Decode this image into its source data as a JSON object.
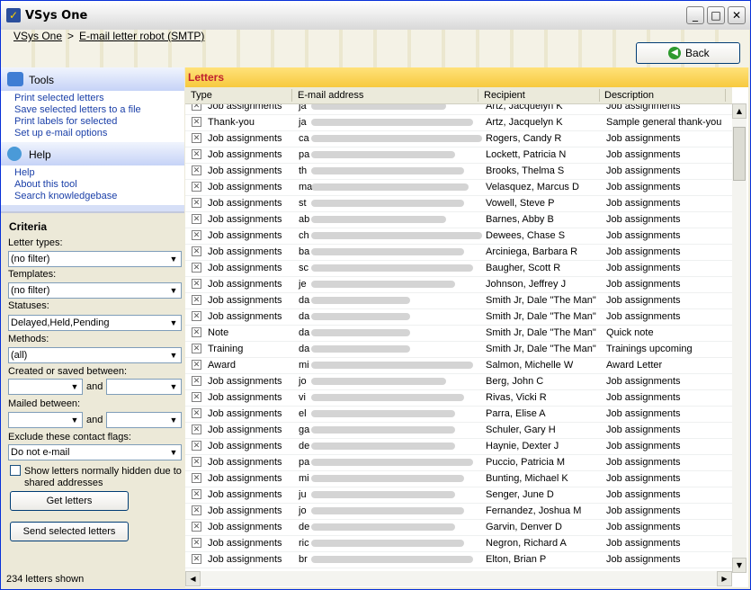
{
  "window": {
    "title": "VSys One"
  },
  "breadcrumb": {
    "home": "VSys One",
    "separator": ">",
    "current": "E-mail letter robot (SMTP)"
  },
  "back_button": {
    "label": "Back"
  },
  "tools": {
    "title": "Tools",
    "links": [
      "Print selected letters",
      "Save selected letters to a file",
      "Print labels for selected",
      "Set up e-mail options"
    ]
  },
  "help": {
    "title": "Help",
    "links": [
      "Help",
      "About this tool",
      "Search knowledgebase"
    ]
  },
  "criteria": {
    "title": "Criteria",
    "letter_types_label": "Letter types:",
    "letter_types_value": "(no filter)",
    "templates_label": "Templates:",
    "templates_value": "(no filter)",
    "statuses_label": "Statuses:",
    "statuses_value": "Delayed,Held,Pending",
    "methods_label": "Methods:",
    "methods_value": "(all)",
    "created_label": "Created or saved between:",
    "and_label": "and",
    "mailed_label": "Mailed between:",
    "exclude_label": "Exclude these contact flags:",
    "exclude_value": "Do not e-mail",
    "hidden_checkbox_label": "Show letters normally hidden due to shared addresses",
    "get_letters_button": "Get letters",
    "send_button": "Send selected letters"
  },
  "status": {
    "text": "234 letters shown"
  },
  "letters": {
    "title": "Letters",
    "columns": [
      "Type",
      "E-mail address",
      "Recipient",
      "Description"
    ],
    "rows": [
      {
        "type": "Job assignments",
        "email": "ja",
        "recipient": "Artz, Jacquelyn K",
        "description": "Job assignments"
      },
      {
        "type": "Thank-you",
        "email": "ja",
        "recipient": "Artz, Jacquelyn K",
        "description": "Sample general thank-you"
      },
      {
        "type": "Job assignments",
        "email": "ca",
        "recipient": "Rogers, Candy R",
        "description": "Job assignments"
      },
      {
        "type": "Job assignments",
        "email": "pa",
        "recipient": "Lockett, Patricia N",
        "description": "Job assignments"
      },
      {
        "type": "Job assignments",
        "email": "th",
        "recipient": "Brooks, Thelma S",
        "description": "Job assignments"
      },
      {
        "type": "Job assignments",
        "email": "ma",
        "recipient": "Velasquez, Marcus D",
        "description": "Job assignments"
      },
      {
        "type": "Job assignments",
        "email": "st",
        "recipient": "Vowell, Steve P",
        "description": "Job assignments"
      },
      {
        "type": "Job assignments",
        "email": "ab",
        "recipient": "Barnes, Abby B",
        "description": "Job assignments"
      },
      {
        "type": "Job assignments",
        "email": "ch",
        "recipient": "Dewees, Chase S",
        "description": "Job assignments"
      },
      {
        "type": "Job assignments",
        "email": "ba",
        "recipient": "Arciniega, Barbara R",
        "description": "Job assignments"
      },
      {
        "type": "Job assignments",
        "email": "sc",
        "recipient": "Baugher, Scott R",
        "description": "Job assignments"
      },
      {
        "type": "Job assignments",
        "email": "je",
        "recipient": "Johnson, Jeffrey J",
        "description": "Job assignments"
      },
      {
        "type": "Job assignments",
        "email": "da",
        "recipient": "Smith Jr, Dale \"The Man\"",
        "description": "Job assignments"
      },
      {
        "type": "Job assignments",
        "email": "da",
        "recipient": "Smith Jr, Dale \"The Man\"",
        "description": "Job assignments"
      },
      {
        "type": "Note",
        "email": "da",
        "recipient": "Smith Jr, Dale \"The Man\"",
        "description": "Quick note"
      },
      {
        "type": "Training",
        "email": "da",
        "recipient": "Smith Jr, Dale \"The Man\"",
        "description": "Trainings upcoming"
      },
      {
        "type": "Award",
        "email": "mi",
        "recipient": "Salmon, Michelle W",
        "description": "Award Letter"
      },
      {
        "type": "Job assignments",
        "email": "jo",
        "recipient": "Berg, John C",
        "description": "Job assignments"
      },
      {
        "type": "Job assignments",
        "email": "vi",
        "recipient": "Rivas, Vicki R",
        "description": "Job assignments"
      },
      {
        "type": "Job assignments",
        "email": "el",
        "recipient": "Parra, Elise A",
        "description": "Job assignments"
      },
      {
        "type": "Job assignments",
        "email": "ga",
        "recipient": "Schuler, Gary H",
        "description": "Job assignments"
      },
      {
        "type": "Job assignments",
        "email": "de",
        "recipient": "Haynie, Dexter J",
        "description": "Job assignments"
      },
      {
        "type": "Job assignments",
        "email": "pa",
        "recipient": "Puccio, Patricia M",
        "description": "Job assignments"
      },
      {
        "type": "Job assignments",
        "email": "mi",
        "recipient": "Bunting, Michael K",
        "description": "Job assignments"
      },
      {
        "type": "Job assignments",
        "email": "ju",
        "recipient": "Senger, June D",
        "description": "Job assignments"
      },
      {
        "type": "Job assignments",
        "email": "jo",
        "recipient": "Fernandez, Joshua M",
        "description": "Job assignments"
      },
      {
        "type": "Job assignments",
        "email": "de",
        "recipient": "Garvin, Denver D",
        "description": "Job assignments"
      },
      {
        "type": "Job assignments",
        "email": "ric",
        "recipient": "Negron, Richard A",
        "description": "Job assignments"
      },
      {
        "type": "Job assignments",
        "email": "br",
        "recipient": "Elton, Brian P",
        "description": "Job assignments"
      }
    ]
  }
}
